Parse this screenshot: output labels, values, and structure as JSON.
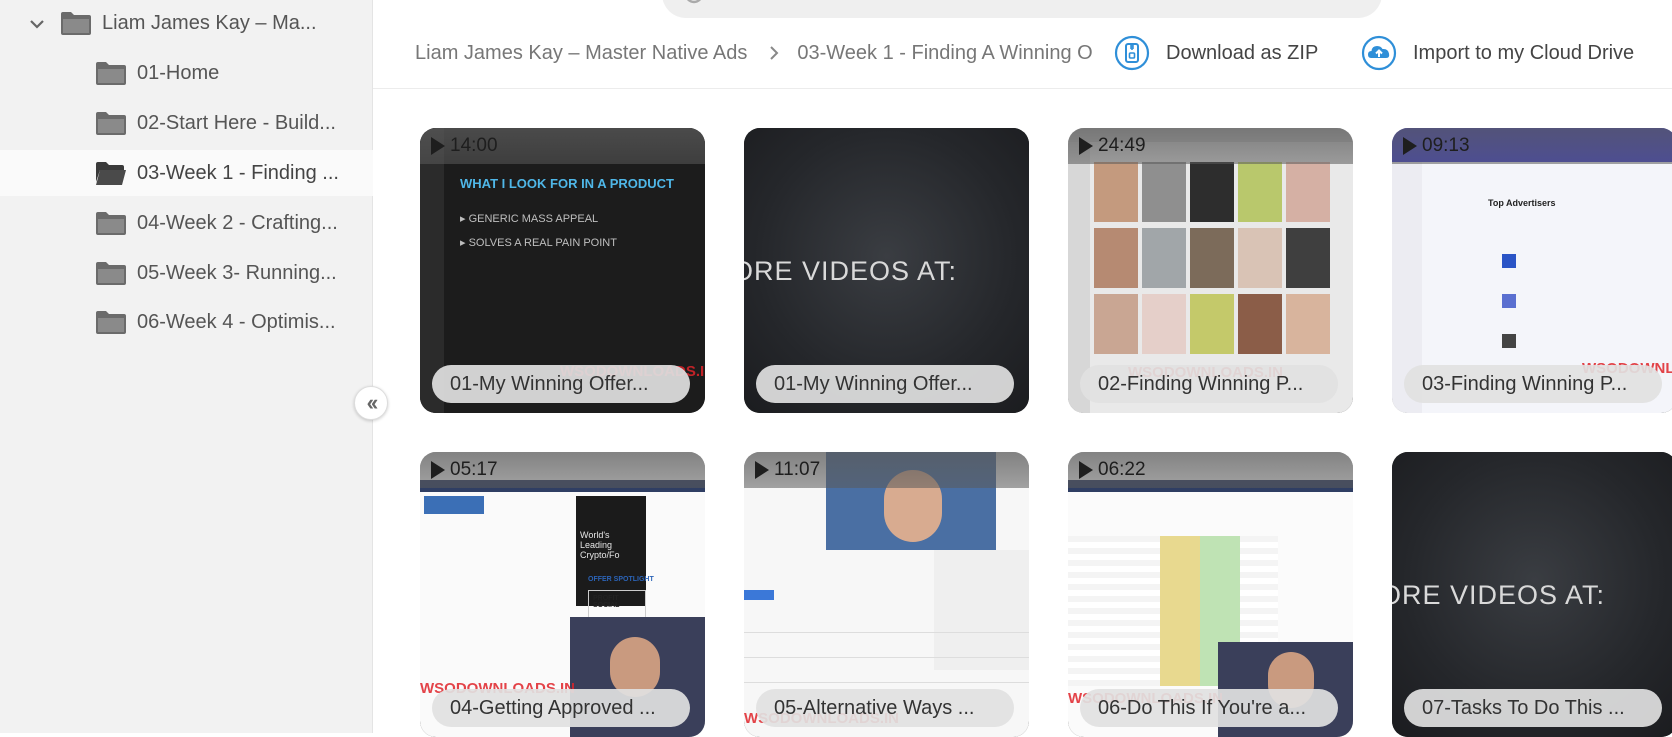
{
  "sidebar": {
    "root": {
      "label": "Liam James Kay – Ma..."
    },
    "items": [
      {
        "label": "01-Home"
      },
      {
        "label": "02-Start Here - Build..."
      },
      {
        "label": "03-Week 1 - Finding ...",
        "active": true
      },
      {
        "label": "04-Week 2 - Crafting..."
      },
      {
        "label": "05-Week 3- Running..."
      },
      {
        "label": "06-Week 4 - Optimis..."
      }
    ],
    "collapse_icon": "double-chevron-left-icon"
  },
  "breadcrumb": {
    "items": [
      "Liam James Kay – Master Native Ads",
      "03-Week 1 - Finding A Winning O"
    ]
  },
  "actions": {
    "download": "Download as ZIP",
    "import": "Import to my Cloud Drive"
  },
  "videos": [
    {
      "duration": "14:00",
      "title": "01-My Winning Offer..."
    },
    {
      "duration": "",
      "title": "01-My Winning Offer..."
    },
    {
      "duration": "24:49",
      "title": "02-Finding Winning P..."
    },
    {
      "duration": "09:13",
      "title": "03-Finding Winning P..."
    },
    {
      "duration": "05:17",
      "title": "04-Getting Approved ..."
    },
    {
      "duration": "11:07",
      "title": "05-Alternative Ways ..."
    },
    {
      "duration": "06:22",
      "title": "06-Do This If You're a..."
    },
    {
      "duration": "",
      "title": "07-Tasks To Do This ..."
    }
  ],
  "thumb_text": {
    "slide_title": "WHAT I LOOK FOR IN A PRODUCT",
    "slide_bullets": [
      "GENERIC MASS APPEAL",
      "SOLVES A REAL PAIN POINT"
    ],
    "more_videos": "ORE VIDEOS AT:",
    "watermark": "WSODOWNLOADS.IN",
    "top_advertisers": "Top Advertisers",
    "worlds_leading": "World's Leading Crypto/Fo",
    "offer_spotlight": "OFFER SPOTLIGHT",
    "profit_social": "PROFIT SOCIAL"
  },
  "colors": {
    "sidebar_bg": "#f2f2f2",
    "accent": "#2f8fd8",
    "pill_bg": "#e1e1e1"
  }
}
